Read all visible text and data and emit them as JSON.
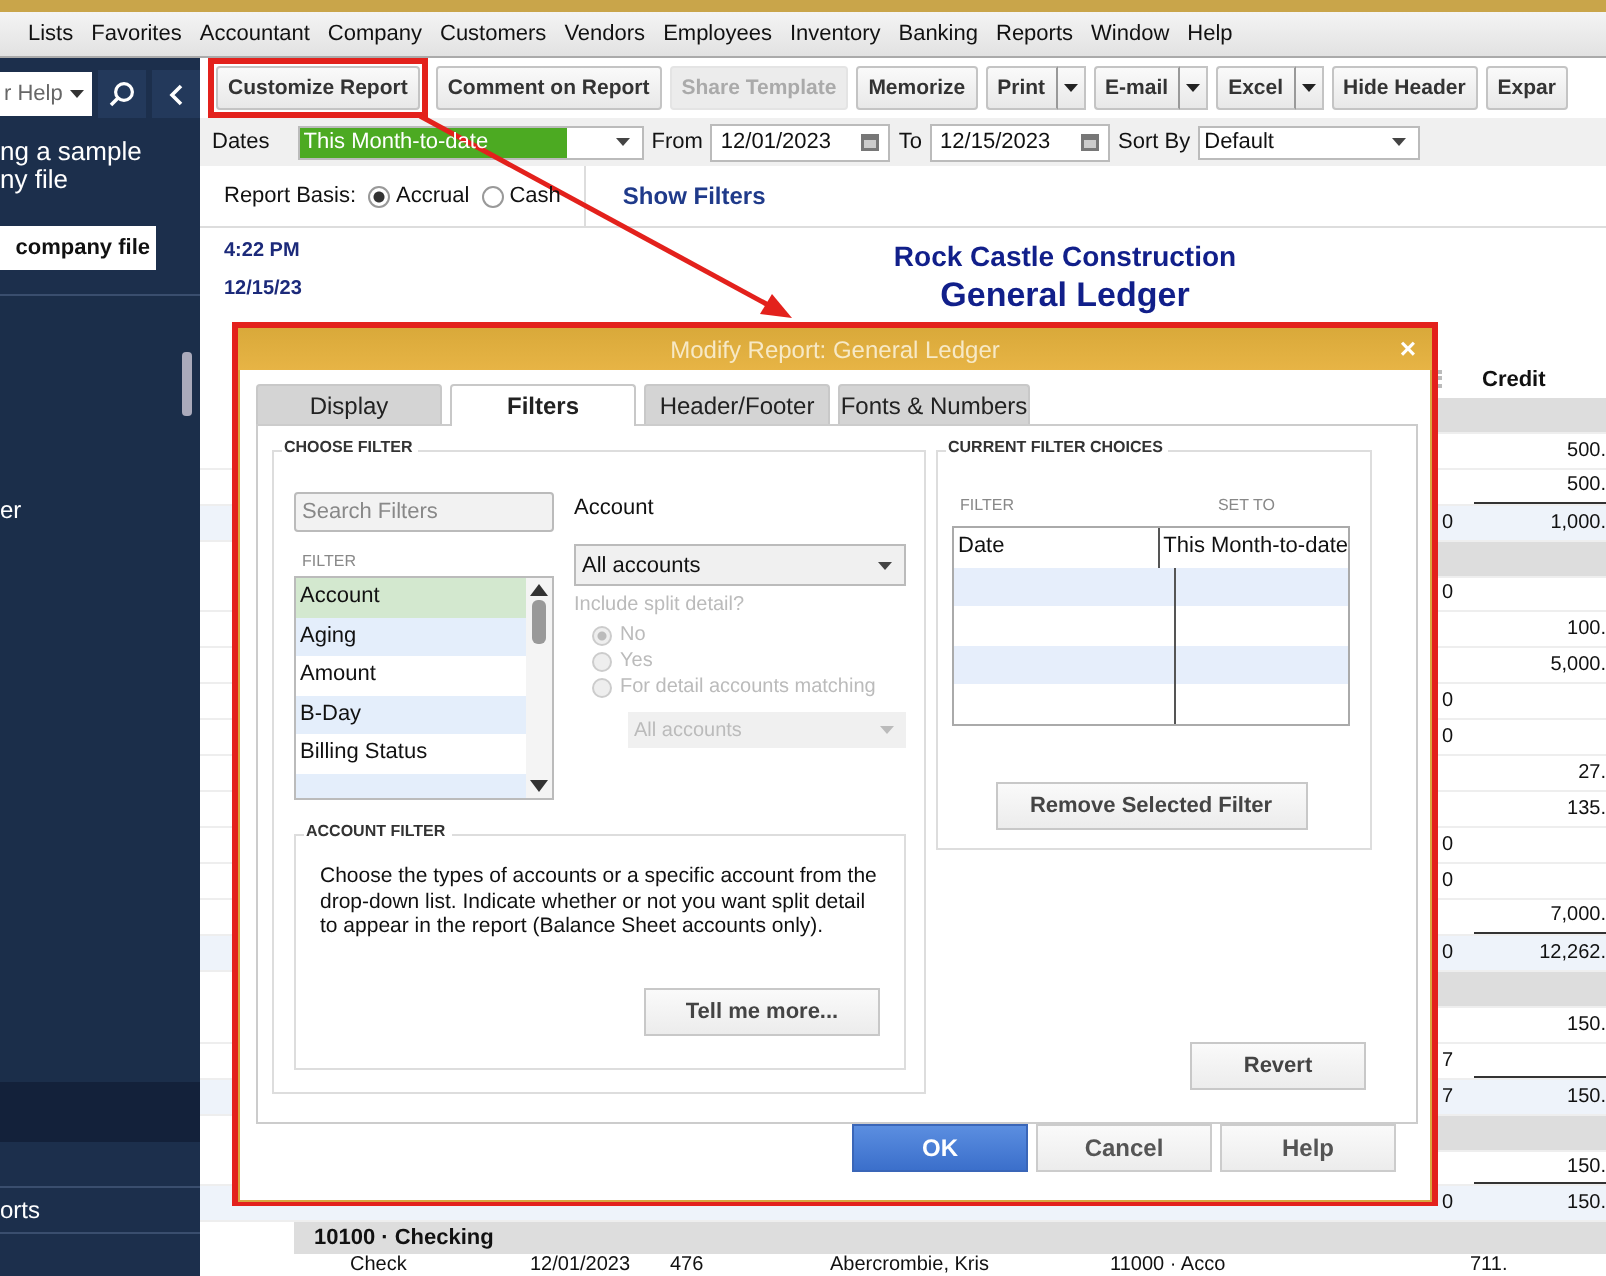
{
  "menu_bar": {
    "items": [
      "Lists",
      "Favorites",
      "Accountant",
      "Company",
      "Customers",
      "Vendors",
      "Employees",
      "Inventory",
      "Banking",
      "Reports",
      "Window",
      "Help"
    ]
  },
  "sidebar": {
    "search_placeholder": "r Help",
    "message_lines": [
      "ng a sample",
      "ny file"
    ],
    "open_button": "company file",
    "list_label": "er",
    "bottom_label": "orts"
  },
  "toolbar": [
    {
      "label": "Customize Report",
      "disabled": false,
      "has_menu": false,
      "highlighted": true
    },
    {
      "label": "Comment on Report",
      "disabled": false,
      "has_menu": false,
      "highlighted": false
    },
    {
      "label": "Share Template",
      "disabled": true,
      "has_menu": false,
      "highlighted": false
    },
    {
      "label": "Memorize",
      "disabled": false,
      "has_menu": false,
      "highlighted": false
    },
    {
      "label": "Print",
      "disabled": false,
      "has_menu": true,
      "highlighted": false
    },
    {
      "label": "E-mail",
      "disabled": false,
      "has_menu": true,
      "highlighted": false
    },
    {
      "label": "Excel",
      "disabled": false,
      "has_menu": true,
      "highlighted": false
    },
    {
      "label": "Hide Header",
      "disabled": false,
      "has_menu": false,
      "highlighted": false
    },
    {
      "label": "Expar",
      "disabled": false,
      "has_menu": false,
      "highlighted": false
    }
  ],
  "dates": {
    "label": "Dates",
    "value": "This Month-to-date",
    "from_label": "From",
    "from": "12/01/2023",
    "to_label": "To",
    "to": "12/15/2023",
    "sort_label": "Sort By",
    "sort": "Default"
  },
  "report_basis": {
    "label": "Report Basis:",
    "options": [
      {
        "label": "Accrual",
        "selected": true
      },
      {
        "label": "Cash",
        "selected": false
      }
    ],
    "show_filters": "Show Filters"
  },
  "report": {
    "time": "4:22 PM",
    "date": "12/15/23",
    "company": "Rock Castle Construction",
    "title": "General Ledger",
    "column_header": "Credit",
    "rows": [
      {
        "kind": "band"
      },
      {
        "kind": "entry",
        "col_a": "",
        "credit": "500."
      },
      {
        "kind": "entry",
        "col_a": "",
        "credit": "500.",
        "underline": true
      },
      {
        "kind": "total",
        "col_a": "0",
        "credit": "1,000."
      },
      {
        "kind": "band"
      },
      {
        "kind": "entry",
        "col_a": "0",
        "credit": ""
      },
      {
        "kind": "entry",
        "col_a": "",
        "credit": "100."
      },
      {
        "kind": "entry",
        "col_a": "",
        "credit": "5,000."
      },
      {
        "kind": "entry",
        "col_a": "0",
        "credit": ""
      },
      {
        "kind": "entry",
        "col_a": "0",
        "credit": ""
      },
      {
        "kind": "entry",
        "col_a": "",
        "credit": "27."
      },
      {
        "kind": "entry",
        "col_a": "",
        "credit": "135."
      },
      {
        "kind": "entry",
        "col_a": "0",
        "credit": ""
      },
      {
        "kind": "entry",
        "col_a": "0",
        "credit": ""
      },
      {
        "kind": "entry",
        "col_a": "",
        "credit": "7,000.",
        "underline": true
      },
      {
        "kind": "total",
        "col_a": "0",
        "credit": "12,262."
      },
      {
        "kind": "band"
      },
      {
        "kind": "entry",
        "col_a": "",
        "credit": "150."
      },
      {
        "kind": "entry",
        "col_a": "7",
        "credit": "",
        "underline": true
      },
      {
        "kind": "total",
        "col_a": "7",
        "credit": "150."
      },
      {
        "kind": "band"
      },
      {
        "kind": "entry",
        "col_a": "",
        "credit": "150.",
        "underline": true
      },
      {
        "kind": "total",
        "col_a": "0",
        "credit": "150."
      }
    ],
    "section": "10100 · Checking",
    "first_row": [
      "Check",
      "12/01/2023",
      "476",
      "Abercrombie, Kris",
      "11000 · Acco",
      "711."
    ]
  },
  "dialog": {
    "title": "Modify Report: General Ledger",
    "close": "×",
    "tabs": [
      {
        "label": "Display",
        "selected": false
      },
      {
        "label": "Filters",
        "selected": true
      },
      {
        "label": "Header/Footer",
        "selected": false
      },
      {
        "label": "Fonts & Numbers",
        "selected": false
      }
    ],
    "choose_filter": {
      "heading": "CHOOSE FILTER",
      "search_placeholder": "Search Filters",
      "list_heading": "FILTER",
      "filters": [
        {
          "label": "Account",
          "selected": true
        },
        {
          "label": "Aging",
          "selected": false
        },
        {
          "label": "Amount",
          "selected": false
        },
        {
          "label": "B-Day",
          "selected": false
        },
        {
          "label": "Billing Status",
          "selected": false
        }
      ],
      "field_label": "Account",
      "account_value": "All accounts",
      "split_detail": {
        "label": "Include split detail?",
        "disabled": true,
        "options": [
          {
            "label": "No",
            "selected": true
          },
          {
            "label": "Yes",
            "selected": false
          },
          {
            "label": "For detail accounts matching",
            "selected": false
          }
        ],
        "match_value": "All accounts"
      }
    },
    "account_filter": {
      "heading": "ACCOUNT FILTER",
      "text": "Choose the types of accounts or a specific account from the drop-down list. Indicate whether or not you want split detail to appear in the report (Balance Sheet accounts only).",
      "button": "Tell me more..."
    },
    "current_filters": {
      "heading": "CURRENT FILTER CHOICES",
      "columns": [
        "FILTER",
        "SET TO"
      ],
      "rows": [
        {
          "filter": "Date",
          "set_to": "This Month-to-date"
        }
      ],
      "button": "Remove Selected Filter"
    },
    "revert": "Revert",
    "buttons": [
      {
        "label": "OK",
        "primary": true
      },
      {
        "label": "Cancel",
        "primary": false
      },
      {
        "label": "Help",
        "primary": false
      }
    ]
  }
}
